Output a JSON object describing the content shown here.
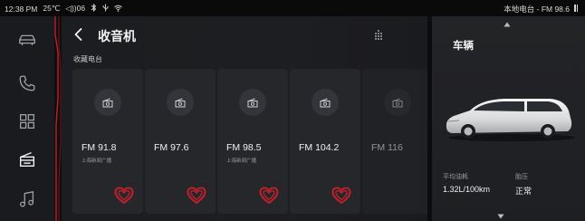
{
  "status_bar": {
    "time": "12:38 PM",
    "temperature": "25℃",
    "volume": "◁))06",
    "station_info": "本地电台 - FM 98.6"
  },
  "nav": {
    "items": [
      {
        "name": "vehicle",
        "icon": "car-icon"
      },
      {
        "name": "phone",
        "icon": "phone-icon"
      },
      {
        "name": "apps",
        "icon": "grid-icon"
      },
      {
        "name": "radio",
        "icon": "radio-icon",
        "active": true
      },
      {
        "name": "music",
        "icon": "music-note-icon"
      }
    ]
  },
  "radio": {
    "title": "收音机",
    "section_label": "收藏电台",
    "stations": [
      {
        "freq": "FM 91.8",
        "sub": "上海新闻广播",
        "favorite": true
      },
      {
        "freq": "FM 97.6",
        "sub": "",
        "favorite": true
      },
      {
        "freq": "FM 98.5",
        "sub": "上海新闻广播",
        "favorite": true
      },
      {
        "freq": "FM 104.2",
        "sub": "",
        "favorite": true
      },
      {
        "freq": "FM 116",
        "sub": "",
        "favorite": false
      }
    ]
  },
  "vehicle_panel": {
    "title": "车辆",
    "fuel_label": "平均油耗",
    "fuel_value": "1.32L/100km",
    "tire_label": "胎压",
    "tire_value": "正常"
  },
  "colors": {
    "accent": "#c0202a",
    "heart": "#c0202a"
  }
}
